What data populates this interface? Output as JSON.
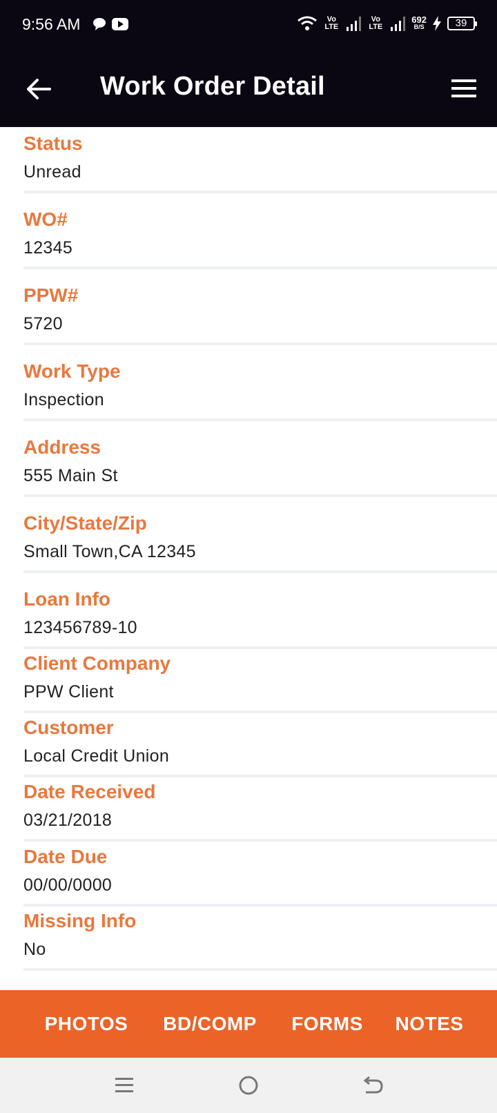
{
  "status_bar": {
    "time": "9:56 AM",
    "volte1": "Vo LTE",
    "volte2": "Vo LTE",
    "speed_value": "692",
    "speed_unit": "B/S",
    "battery": "39"
  },
  "header": {
    "title": "Work Order Detail"
  },
  "fields": [
    {
      "label": "Status",
      "value": "Unread"
    },
    {
      "label": "WO#",
      "value": "12345"
    },
    {
      "label": "PPW#",
      "value": "5720"
    },
    {
      "label": "Work Type",
      "value": "Inspection"
    },
    {
      "label": "Address",
      "value": "555 Main St"
    },
    {
      "label": "City/State/Zip",
      "value": "Small Town,CA 12345"
    },
    {
      "label": "Loan Info",
      "value": "123456789-10"
    },
    {
      "label": "Client Company",
      "value": "PPW Client"
    },
    {
      "label": "Customer",
      "value": "Local Credit Union"
    },
    {
      "label": "Date Received",
      "value": "03/21/2018"
    },
    {
      "label": "Date Due",
      "value": "00/00/0000"
    },
    {
      "label": "Missing Info",
      "value": "No"
    }
  ],
  "tabs": [
    "PHOTOS",
    "BD/COMP",
    "FORMS",
    "NOTES"
  ],
  "colors": {
    "header_bg": "#0a0612",
    "label": "#e8783e",
    "bottom_bar": "#ec6328"
  },
  "icons": {
    "back": "arrow-left-icon",
    "menu": "hamburger-menu-icon",
    "nav_recents": "recents-icon",
    "nav_home": "home-icon",
    "nav_back": "back-icon"
  }
}
